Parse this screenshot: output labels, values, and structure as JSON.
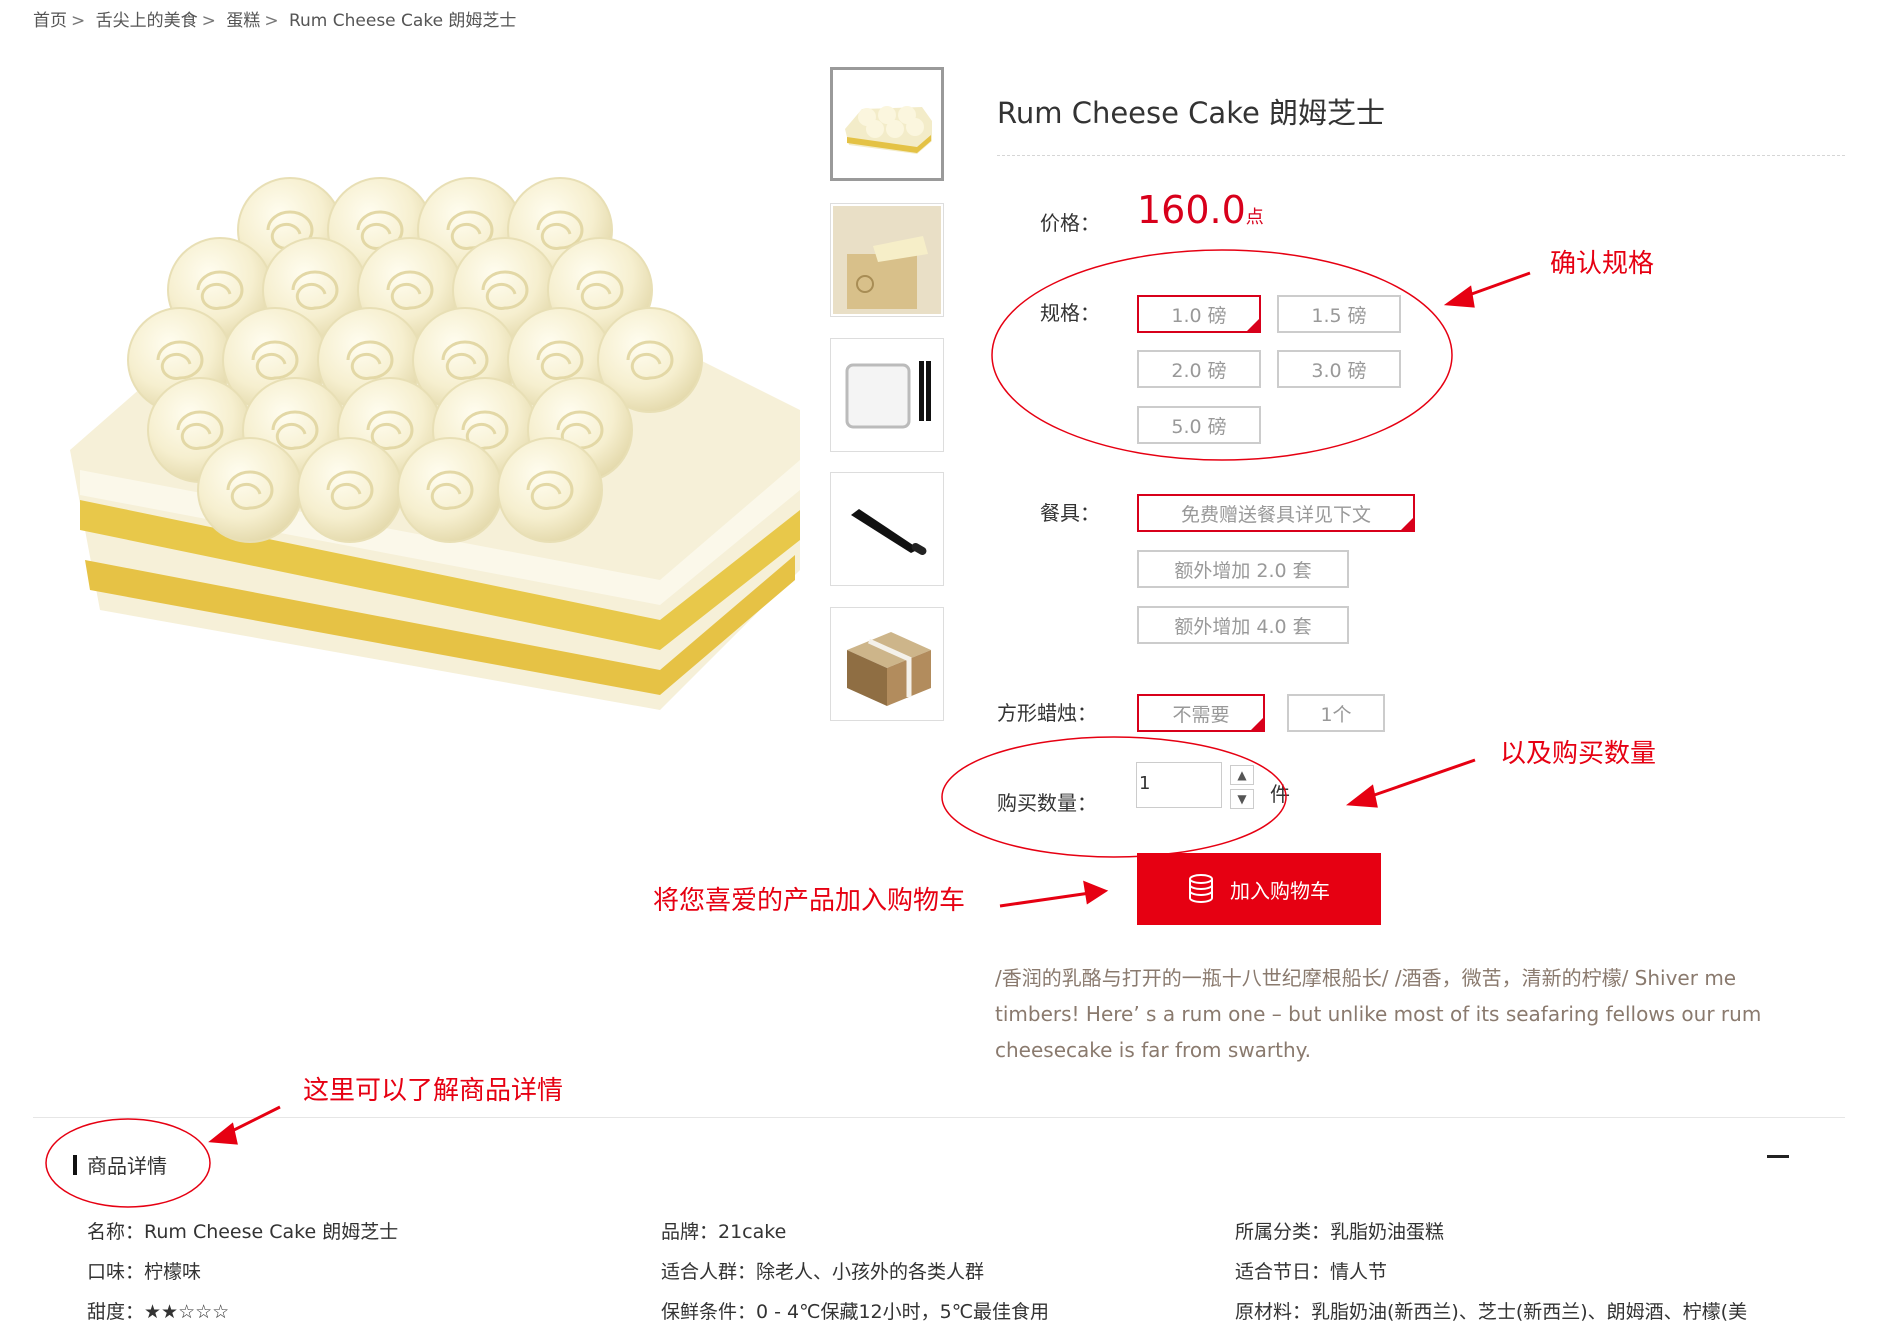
{
  "breadcrumb": {
    "items": [
      "首页",
      "舌尖上的美食",
      "蛋糕",
      "Rum Cheese Cake 朗姆芝士"
    ],
    "separator": ">"
  },
  "product": {
    "title": "Rum Cheese Cake 朗姆芝士",
    "price_label": "价格：",
    "price_value": "160.0",
    "price_unit": "点",
    "spec_label": "规格：",
    "specs": [
      "1.0 磅",
      "1.5 磅",
      "2.0 磅",
      "3.0 磅",
      "5.0 磅"
    ],
    "selected_spec": "1.0 磅",
    "tableware_label": "餐具：",
    "tableware": [
      "免费赠送餐具详见下文",
      "额外增加 2.0 套",
      "额外增加 4.0 套"
    ],
    "candle_label": "方形蜡烛：",
    "candles": [
      "不需要",
      "1个"
    ],
    "qty_label": "购买数量：",
    "qty_value": "1",
    "qty_unit": "件",
    "add_to_cart": "加入购物车",
    "description": "/香润的乳酪与打开的一瓶十八世纪摩根船长/ /酒香，微苦，清新的柠檬/ Shiver me timbers! Here’ s a rum one – but unlike most of its seafaring fellows our rum cheesecake is far from swarthy."
  },
  "details": {
    "heading": "商品详情",
    "col1": [
      "名称：Rum Cheese Cake 朗姆芝士",
      "口味：柠檬味",
      "甜度：★★☆☆☆"
    ],
    "col2": [
      "品牌：21cake",
      "适合人群：除老人、小孩外的各类人群",
      "保鲜条件：0 - 4℃保藏12小时，5℃最佳食用"
    ],
    "col3": [
      "所属分类：乳脂奶油蛋糕",
      "适合节日：情人节",
      "原材料：乳脂奶油(新西兰)、芝士(新西兰)、朗姆酒、柠檬(美"
    ]
  },
  "annotations": {
    "spec": "确认规格",
    "qty": "以及购买数量",
    "cart": "将您喜爱的产品加入购物车",
    "detail": "这里可以了解商品详情"
  },
  "colors": {
    "accent": "#e60012",
    "price": "#d8001b",
    "annotation": "#e60012"
  },
  "icons": {
    "cart": "coin-stack-icon",
    "collapse": "minus-icon"
  }
}
